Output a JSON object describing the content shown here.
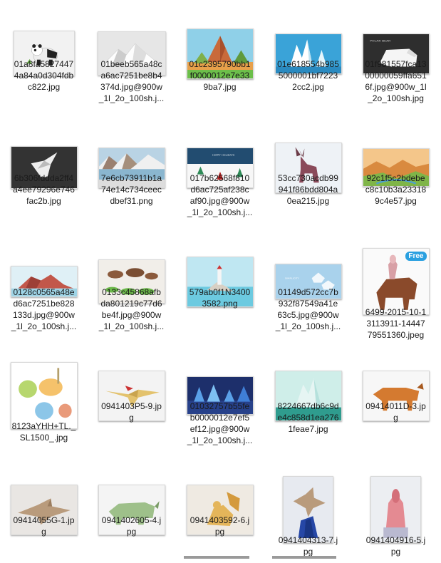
{
  "files": [
    {
      "name": "01a8fa58274474a84a0d304fdbc822.jpg",
      "lines": [
        "01a8fa5827447",
        "4a84a0d304fdb",
        "c822.jpg"
      ],
      "thumb": "panda"
    },
    {
      "name": "01beeb565a48ca6ac7251be8b4374d.jpg@900w_1l_2o_100sh.j...",
      "lines": [
        "01beeb565a48c",
        "a6ac7251be8b4",
        "374d.jpg@900w",
        "_1l_2o_100sh.j..."
      ],
      "thumb": "mountain-white"
    },
    {
      "name": "01c2395790bb1f0000012e7e339ba7.jpg",
      "lines": [
        "01c2395790bb1",
        "f0000012e7e33",
        "9ba7.jpg"
      ],
      "thumb": "landscape-peak"
    },
    {
      "name": "01e618554b9855000001bf72232cc2.jpg",
      "lines": [
        "01e618554b985",
        "5000001bf7223",
        "2cc2.jpg"
      ],
      "thumb": "ice-blue"
    },
    {
      "name": "01f981557fca1300000059ffa6516f.jpg@900w_1l_2o_100sh.jpg",
      "lines": [
        "01f981557fca13",
        "00000059ffa651",
        "6f.jpg@900w_1l",
        "_2o_100sh.jpg"
      ],
      "thumb": "polar-bear"
    },
    {
      "name": "6b306fddda2ff4a4ee79296e746fac2b.jpg",
      "lines": [
        "6b306fddda2ff4",
        "a4ee79296e746",
        "fac2b.jpg"
      ],
      "thumb": "dark-crane"
    },
    {
      "name": "7e6cb73911b1a74e14c734ceecdbef31.png",
      "lines": [
        "7e6cb73911b1a",
        "74e14c734ceec",
        "dbef31.png"
      ],
      "thumb": "lake-mountains"
    },
    {
      "name": "017b62568f810d6ac725af238caf90.jpg@900w_1l_2o_100sh.j...",
      "lines": [
        "017b62568f810",
        "d6ac725af238c",
        "af90.jpg@900w",
        "_1l_2o_100sh.j..."
      ],
      "thumb": "winter-scene"
    },
    {
      "name": "53cc730acdb99941f86bdd804a0ea215.jpg",
      "lines": [
        "53cc730acdb99",
        "941f86bdd804a",
        "0ea215.jpg"
      ],
      "thumb": "deer"
    },
    {
      "name": "92c1f5c2bdebec8c10b3a233189c4e57.jpg",
      "lines": [
        "92c1f5c2bdebe",
        "c8c10b3a23318",
        "9c4e57.jpg"
      ],
      "thumb": "desert-valley"
    },
    {
      "name": "0128c0565a48ed6ac7251be828133d.jpg@900w_1l_2o_100sh.j...",
      "lines": [
        "0128c0565a48e",
        "d6ac7251be828",
        "133d.jpg@900w",
        "_1l_2o_100sh.j..."
      ],
      "thumb": "red-island"
    },
    {
      "name": "0133c45868afbda801219c77d6be4f.jpg@900w_1l_2o_100sh.j...",
      "lines": [
        "0133c45868afb",
        "da801219c77d6",
        "be4f.jpg@900w",
        "_1l_2o_100sh.j..."
      ],
      "thumb": "rock-platforms"
    },
    {
      "name": "579ab0f1N34003582.png",
      "lines": [
        "579ab0f1N3400",
        "3582.png"
      ],
      "thumb": "lighthouse"
    },
    {
      "name": "01149d572cc7b932f87549a41e63c5.jpg@900w_1l_2o_100sh.j...",
      "lines": [
        "01149d572cc7b",
        "932f87549a41e",
        "63c5.jpg@900w",
        "_1l_2o_100sh.j..."
      ],
      "thumb": "pale-blue"
    },
    {
      "name": "6499-2015-10-13113911-1444779551360.jpeg",
      "lines": [
        "6499-2015-10-1",
        "3113911-14447",
        "79551360.jpeg"
      ],
      "thumb": "ox-rider",
      "badge": "Free"
    },
    {
      "name": "8123aYHH+TL._SL1500_.jpg",
      "lines": [
        "8123aYHH+TL._",
        "SL1500_.jpg"
      ],
      "thumb": "animal-map"
    },
    {
      "name": "0941403P5-9.jpg",
      "lines": [
        "0941403P5-9.jp",
        "g"
      ],
      "thumb": "pterosaur"
    },
    {
      "name": "01032757b55feb0000012e7ef5ef12.jpg@900w_1l_2o_100sh.j...",
      "lines": [
        "01032757b55fe",
        "b0000012e7ef5",
        "ef12.jpg@900w",
        "_1l_2o_100sh.j..."
      ],
      "thumb": "blue-forest"
    },
    {
      "name": "8224667db6c9de4c858d1ea2761feae7.jpg",
      "lines": [
        "8224667db6c9d",
        "e4c858d1ea276",
        "1feae7.jpg"
      ],
      "thumb": "iceberg-teal"
    },
    {
      "name": "09414011D-3.jpg",
      "lines": [
        "09414011D-3.jp",
        "g"
      ],
      "thumb": "ox-orange"
    },
    {
      "name": "09414055G-1.jpg",
      "lines": [
        "09414055G-1.jp",
        "g"
      ],
      "thumb": "shark-origami"
    },
    {
      "name": "0941402605-4.jpg",
      "lines": [
        "0941402605-4.j",
        "pg"
      ],
      "thumb": "money-rhino"
    },
    {
      "name": "0941403592-6.jpg",
      "lines": [
        "0941403592-6.j",
        "pg"
      ],
      "thumb": "squirrel"
    },
    {
      "name": "0941404313-7.jpg",
      "lines": [
        "0941404313-7.j",
        "pg"
      ],
      "thumb": "shark-blue"
    },
    {
      "name": "0941404916-5.jpg",
      "lines": [
        "0941404916-5.j",
        "pg"
      ],
      "thumb": "pink-gorilla"
    }
  ]
}
